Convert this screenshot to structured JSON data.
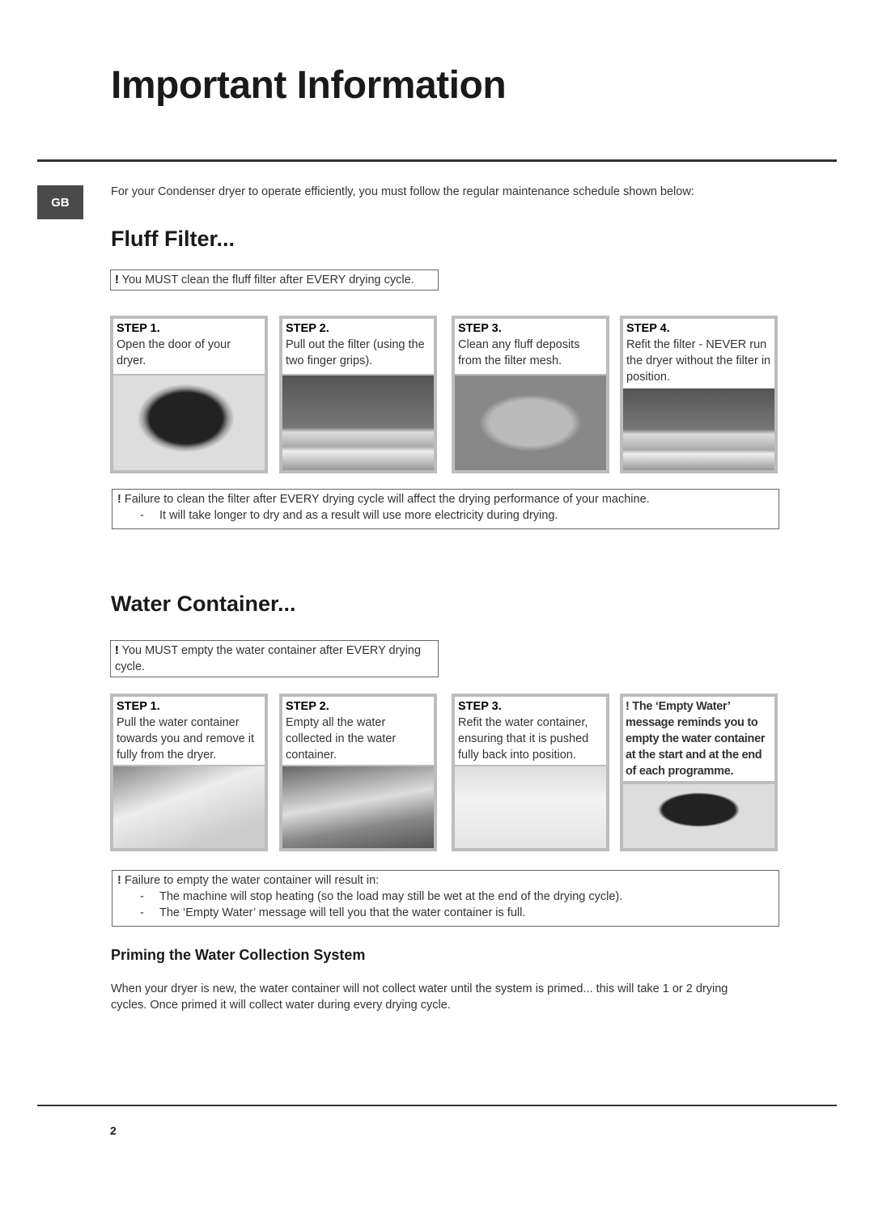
{
  "title": "Important Information",
  "lang_badge": "GB",
  "intro": "For your Condenser dryer to operate efficiently, you must follow the regular maintenance schedule shown below:",
  "fluff": {
    "heading": "Fluff Filter...",
    "note": "You MUST clean the fluff filter after EVERY drying cycle.",
    "steps": [
      {
        "label": "STEP 1.",
        "text": "Open the door of your dryer."
      },
      {
        "label": "STEP 2.",
        "text": "Pull out the filter (using the two finger grips)."
      },
      {
        "label": "STEP 3.",
        "text": "Clean any fluff deposits from the filter mesh."
      },
      {
        "label": "STEP 4.",
        "text": "Refit the filter - NEVER run the dryer without the filter in position."
      }
    ],
    "warning": "Failure to clean the filter after EVERY drying cycle will affect the drying performance of your machine.",
    "warning_items": [
      "It will take longer to dry and as a result will use more electricity during drying."
    ]
  },
  "water": {
    "heading": "Water Container...",
    "note": "You MUST empty the water container after EVERY drying cycle.",
    "steps": [
      {
        "label": "STEP 1.",
        "text": "Pull the water container towards you and remove it fully from the dryer."
      },
      {
        "label": "STEP 2.",
        "text": "Empty all the water collected in the water container."
      },
      {
        "label": "STEP 3.",
        "text": "Refit the water container, ensuring that it is pushed fully back into position."
      }
    ],
    "reminder": "The ‘Empty Water’ message reminds you to empty the water container at the start and at the end of each programme.",
    "warning": "Failure to empty the water container will result in:",
    "warning_items": [
      "The machine will stop heating (so the load may still be wet at the end of the drying cycle).",
      "The ‘Empty Water’ message will tell you that the water container is full."
    ]
  },
  "priming": {
    "heading": "Priming the Water Collection System",
    "text": "When your dryer is new, the water container will not collect water until the system is primed... this will take 1 or 2 drying cycles. Once primed it will collect water during every drying cycle."
  },
  "page_number": "2",
  "exclaim": "!"
}
